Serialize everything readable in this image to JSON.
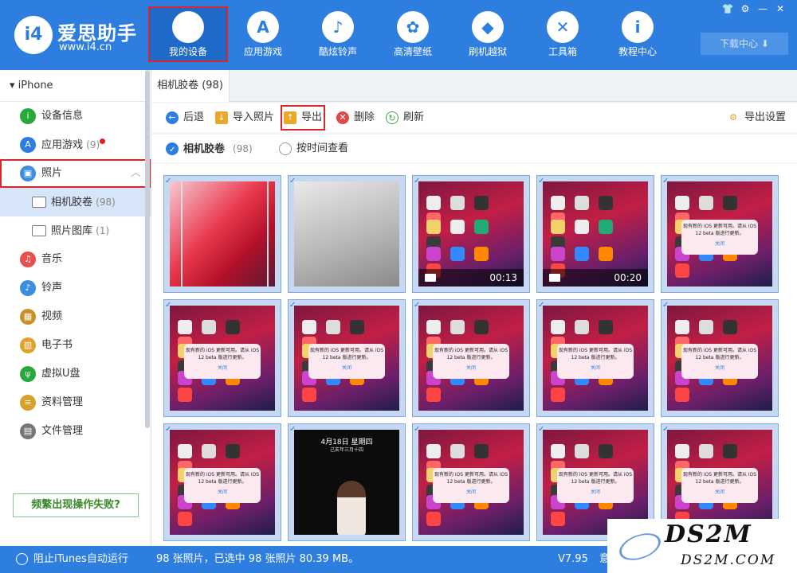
{
  "app": {
    "name": "爱思助手",
    "url": "www.i4.cn",
    "logo_letters": "i4"
  },
  "nav": [
    {
      "label": "我的设备",
      "icon": "apple-icon",
      "active": true
    },
    {
      "label": "应用游戏",
      "icon": "appstore-icon"
    },
    {
      "label": "酷炫铃声",
      "icon": "bell-icon"
    },
    {
      "label": "高清壁纸",
      "icon": "flower-icon"
    },
    {
      "label": "刷机越狱",
      "icon": "dropbox-icon"
    },
    {
      "label": "工具箱",
      "icon": "tools-icon"
    },
    {
      "label": "教程中心",
      "icon": "info-icon"
    }
  ],
  "download_label": "下载中心",
  "device": "iPhone",
  "sidebar": [
    {
      "label": "设备信息",
      "icon": "info-circle-icon",
      "color": "#27a83a"
    },
    {
      "label": "应用游戏",
      "count": "(9)",
      "icon": "appstore-icon",
      "color": "#2e7ee0"
    },
    {
      "label": "照片",
      "icon": "photo-icon",
      "color": "#3c8fe0"
    },
    {
      "label": "相机胶卷",
      "count": "(98)",
      "icon": "folder-icon"
    },
    {
      "label": "照片图库",
      "count": "(1)",
      "icon": "folder-icon"
    },
    {
      "label": "音乐",
      "icon": "music-icon",
      "color": "#e8504f"
    },
    {
      "label": "铃声",
      "icon": "bell-icon",
      "color": "#3c8fe0"
    },
    {
      "label": "视频",
      "icon": "film-icon",
      "color": "#c9902a"
    },
    {
      "label": "电子书",
      "icon": "book-icon",
      "color": "#e0a22a"
    },
    {
      "label": "虚拟U盘",
      "icon": "usb-icon",
      "color": "#27a83a"
    },
    {
      "label": "资料管理",
      "icon": "notes-icon",
      "color": "#d9a02a"
    },
    {
      "label": "文件管理",
      "icon": "file-icon",
      "color": "#777777"
    }
  ],
  "help_button": "频繁出现操作失败?",
  "tab": "相机胶卷 (98)",
  "toolbar": {
    "back": "后退",
    "import": "导入照片",
    "export": "导出",
    "delete": "删除",
    "refresh": "刷新",
    "export_settings": "导出设置"
  },
  "filters": {
    "camera_roll": "相机胶卷",
    "camera_roll_count": "(98)",
    "by_time": "按时间查看"
  },
  "thumbs": [
    {
      "kind": "red"
    },
    {
      "kind": "gray"
    },
    {
      "kind": "home",
      "duration": "00:13"
    },
    {
      "kind": "home",
      "duration": "00:20"
    },
    {
      "kind": "alert"
    },
    {
      "kind": "alert"
    },
    {
      "kind": "alert"
    },
    {
      "kind": "alert"
    },
    {
      "kind": "alert"
    },
    {
      "kind": "alert"
    },
    {
      "kind": "alert"
    },
    {
      "kind": "lock"
    },
    {
      "kind": "alert"
    },
    {
      "kind": "alert"
    },
    {
      "kind": "alert"
    }
  ],
  "alert_text": "现有新的 iOS 更新可用。请从 iOS 12 beta 版进行更新。",
  "alert_close": "关闭",
  "lock_date": "4月18日 星期四",
  "lock_sub": "己亥年三月十四",
  "status": {
    "itunes": "阻止iTunes自动运行",
    "stats": "98 张照片，已选中 98 张照片 80.39 MB。",
    "version": "V7.95",
    "update": "意"
  },
  "watermark": {
    "line1": "DS2M",
    "line2": "DS2M.COM"
  }
}
